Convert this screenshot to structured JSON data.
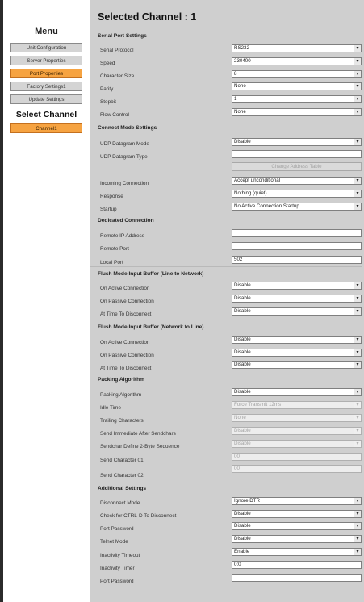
{
  "sidebar": {
    "menu_title": "Menu",
    "items": [
      {
        "label": "Unit Configuration",
        "active": false
      },
      {
        "label": "Server Properties",
        "active": false
      },
      {
        "label": "Port Properties",
        "active": true
      },
      {
        "label": "Factory Settings1",
        "active": false
      },
      {
        "label": "Update Settings",
        "active": false
      }
    ],
    "select_channel_title": "Select Channel",
    "channel_button": "Channel1"
  },
  "main": {
    "title": "Selected Channel : 1",
    "sections": {
      "serial": "Serial Port Settings",
      "connect": "Connect Mode Settings",
      "dedicated": "Dedicated Connection",
      "flush_line": "Flush Mode Input Buffer (Line to Network)",
      "flush_net": "Flush Mode Input Buffer (Network to Line)",
      "packing": "Packing Algorithm",
      "additional": "Additional Settings"
    },
    "serial": {
      "protocol_label": "Serial Protocol",
      "protocol_value": "RS232",
      "speed_label": "Speed",
      "speed_value": "230400",
      "charsize_label": "Character Size",
      "charsize_value": "8",
      "parity_label": "Parity",
      "parity_value": "None",
      "stopbit_label": "Stopbit",
      "stopbit_value": "1",
      "flow_label": "Flow Control",
      "flow_value": "None"
    },
    "connect": {
      "udp_mode_label": "UDP Datagram Mode",
      "udp_mode_value": "Disable",
      "udp_type_label": "UDP Datagram Type",
      "udp_type_value": "",
      "change_table_button": "Change Address Table",
      "incoming_label": "Incoming Connection",
      "incoming_value": "Accept unconditional",
      "response_label": "Response",
      "response_value": "Nothing (quiet)",
      "startup_label": "Startup",
      "startup_value": "No Active Connection Startup"
    },
    "dedicated": {
      "remote_ip_label": "Remote IP Address",
      "remote_ip_value": "",
      "remote_port_label": "Remote Port",
      "remote_port_value": "",
      "local_port_label": "Local Port",
      "local_port_value": "502"
    },
    "flush_line": {
      "active_label": "On Active Connection",
      "active_value": "Disable",
      "passive_label": "On Passive Connection",
      "passive_value": "Disable",
      "disconnect_label": "At Time To Disconnect",
      "disconnect_value": "Disable"
    },
    "flush_net": {
      "active_label": "On Active Connection",
      "active_value": "Disable",
      "passive_label": "On Passive Connection",
      "passive_value": "Disable",
      "disconnect_label": "At Time To Disconnect",
      "disconnect_value": "Disable"
    },
    "packing": {
      "algorithm_label": "Packing Algorithm",
      "algorithm_value": "Disable",
      "idle_label": "Idle Time",
      "idle_value": "Force Transmit 12ms",
      "trailing_label": "Trailing Characters",
      "trailing_value": "None",
      "send_immediate_label": "Send Immediate After Sendchars",
      "send_immediate_value": "Disable",
      "sendchar_define_label": "Sendchar Define 2-Byte Sequence",
      "sendchar_define_value": "Disable",
      "char01_label": "Send Character 01",
      "char01_value": "00",
      "char02_label": "Send Character 02",
      "char02_value": "00"
    },
    "additional": {
      "disconnect_mode_label": "Disconnect Mode",
      "disconnect_mode_value": "Ignore DTR",
      "ctrl_d_label": "Check for CTRL-D To Disconnect",
      "ctrl_d_value": "Disable",
      "port_password_label": "Port Password",
      "port_password_value": "Disable",
      "telnet_label": "Telnet Mode",
      "telnet_value": "Disable",
      "inactivity_timeout_label": "Inactivity Timeout",
      "inactivity_timeout_value": "Enable",
      "inactivity_timer_label": "Inactivity Timer",
      "inactivity_timer_value": "0:0",
      "port_password2_label": "Port Password",
      "port_password2_value": ""
    }
  }
}
